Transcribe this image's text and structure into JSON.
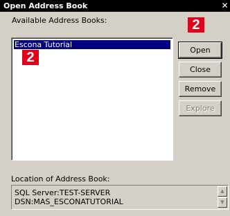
{
  "window": {
    "title": "Open Address Book",
    "close_label": "✕"
  },
  "available": {
    "label": "Available Address Books:",
    "items": [
      "Escona Tutorial"
    ]
  },
  "buttons": {
    "open": "Open",
    "close": "Close",
    "remove": "Remove",
    "explore": "Explore"
  },
  "location": {
    "label": "Location of Address Book:",
    "lines": [
      "SQL Server:TEST-SERVER",
      "DSN:MAS_ESCONATUTORIAL"
    ]
  },
  "badges": [
    "2",
    "2"
  ],
  "colors": {
    "badge": "#e2001a",
    "selection": "#000080",
    "face": "#d4d0c8"
  }
}
